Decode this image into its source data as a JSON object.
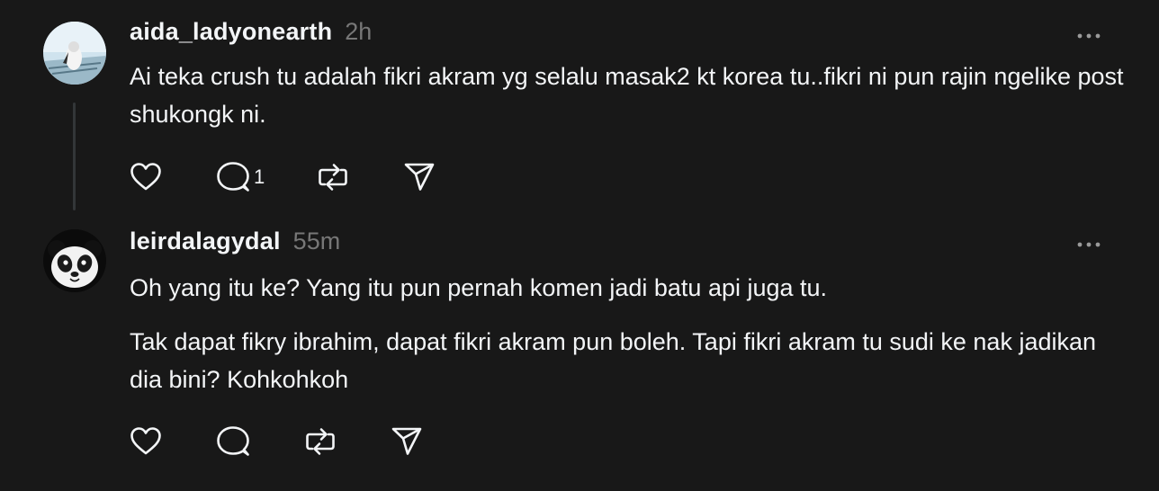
{
  "posts": [
    {
      "username": "aida_ladyonearth",
      "time": "2h",
      "body": [
        "Ai teka crush tu adalah fikri akram yg selalu masak2 kt korea tu..fikri ni pun rajin ngelike post shukongk ni."
      ],
      "reply_count": "1",
      "avatar_icon": "profile-photo-icon"
    },
    {
      "username": "leirdalagydal",
      "time": "55m",
      "body": [
        "Oh yang itu ke? Yang itu pun pernah komen jadi batu api juga tu.",
        "Tak dapat fikry ibrahim, dapat fikri akram pun boleh. Tapi fikri akram tu sudi ke nak jadikan dia bini? Kohkohkoh"
      ],
      "reply_count": "",
      "avatar_icon": "panda-icon"
    }
  ],
  "icons": [
    "heart-icon",
    "comment-icon",
    "repost-icon",
    "share-icon",
    "more-icon"
  ],
  "colors": {
    "background": "#181818",
    "text": "#f3f5f7",
    "secondary_text": "#777777",
    "thread_line": "#333638"
  }
}
